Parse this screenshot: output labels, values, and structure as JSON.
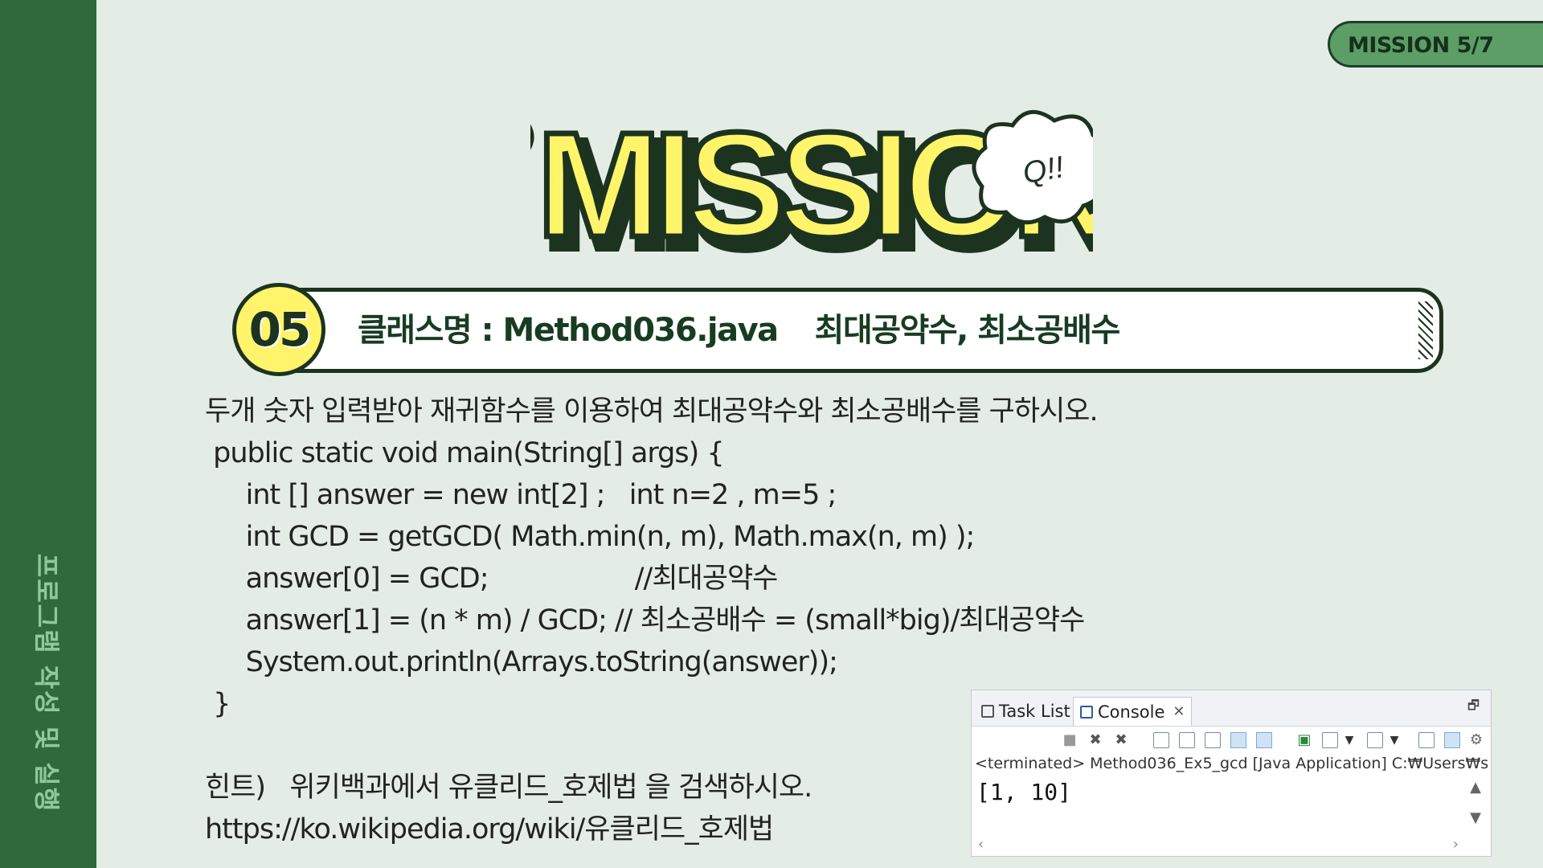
{
  "sidebar": {
    "vertical_text": "프로그램 작성 및 실행"
  },
  "badge": {
    "label": "MISSION 5/7"
  },
  "mission_title": {
    "text": "MISSION",
    "bubble_text": "Q!!"
  },
  "header": {
    "number": "05",
    "class_label": "클래스명 : Method036.java",
    "topic": "최대공약수, 최소공배수"
  },
  "content": {
    "lines": [
      "두개 숫자 입력받아 재귀함수를 이용하여 최대공약수와 최소공배수를 구하시오.",
      " public static void main(String[] args) {",
      "     int [] answer = new int[2] ;   int n=2 , m=5 ;",
      "     int GCD = getGCD( Math.min(n, m), Math.max(n, m) );",
      "     answer[0] = GCD;                  //최대공약수",
      "     answer[1] = (n * m) / GCD; // 최소공배수 = (small*big)/최대공약수",
      "     System.out.println(Arrays.toString(answer));",
      " }",
      "",
      "힌트)   위키백과에서 유클리드_호제법 을 검색하시오.",
      "https://ko.wikipedia.org/wiki/유클리드_호제법"
    ]
  },
  "console": {
    "tabs": [
      {
        "label": "Task List",
        "icon": "task-list-icon"
      },
      {
        "label": "Console",
        "icon": "console-icon"
      }
    ],
    "status_line": "<terminated> Method036_Ex5_gcd [Java Application] C:₩Users₩s",
    "output": "[1, 10]"
  },
  "colors": {
    "background": "#e4ede5",
    "sidebar": "#2f6b3a",
    "title_fill": "#fff46a",
    "title_stroke": "#1c3320",
    "accent_green": "#5c9e66"
  }
}
